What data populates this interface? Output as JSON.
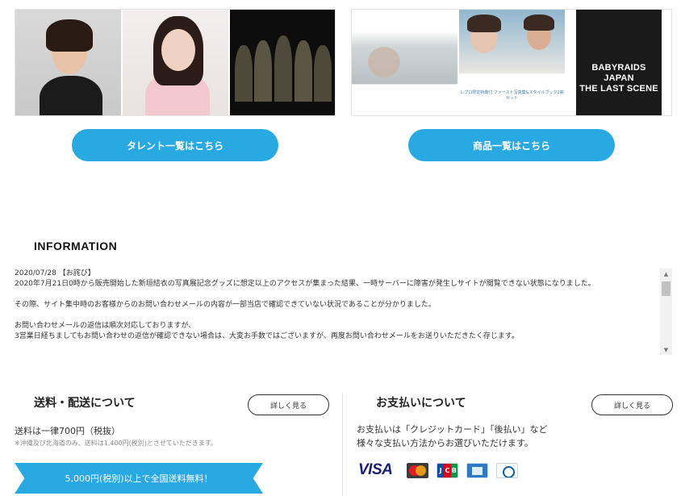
{
  "talent_images": [
    {
      "alt": "talent-1"
    },
    {
      "alt": "talent-2"
    },
    {
      "alt": "talent-3-group"
    }
  ],
  "goods_images": [
    {
      "alt": "photobook-cover"
    },
    {
      "caption": "レプロ限定特典付 ファースト写真集&スタイルブック2冊セット"
    },
    {
      "title_line1": "BABYRAIDS JAPAN",
      "title_line2": "THE LAST SCENE"
    }
  ],
  "buttons": {
    "talent_list": "タレント一覧はこちら",
    "goods_list": "商品一覧はこちら"
  },
  "information": {
    "heading": "INFORMATION",
    "lines": [
      "2020/07/28 【お詫び】",
      "2020年7月21日0時から販売開始した新垣結衣の写真展記念グッズに想定以上のアクセスが集まった結果、一時サーバーに障害が発生しサイトが閲覧できない状態になりました。",
      "",
      "その際、サイト集中時のお客様からのお問い合わせメールの内容が一部当店で確認できていない状況であることが分かりました。",
      "",
      "お問い合わせメールの返信は順次対応しておりますが、",
      "3営業日経ちましてもお問い合わせの返信が確認できない場合は、大変お手数ではございますが、再度お問い合わせメールをお送りいただきたく存じます。"
    ]
  },
  "shipping": {
    "title": "送料・配送について",
    "detail_label": "詳しく見る",
    "text": "送料は一律700円（税抜）",
    "note": "※沖縄及び北海道のみ、送料は1,400円(税別)とさせていただきます。",
    "banner": "5,000円(税別)以上で全国送料無料！"
  },
  "payment": {
    "title": "お支払いについて",
    "detail_label": "詳しく見る",
    "line1": "お支払いは「クレジットカード」「後払い」など",
    "line2": "様々な支払い方法からお選びいただけます。",
    "cards": [
      "VISA",
      "MasterCard",
      "JCB",
      "American Express",
      "Diners Club"
    ],
    "visa_label": "VISA",
    "jcb_letters": [
      "J",
      "C",
      "B"
    ]
  },
  "colors": {
    "accent": "#29a9e1",
    "text": "#333333"
  }
}
